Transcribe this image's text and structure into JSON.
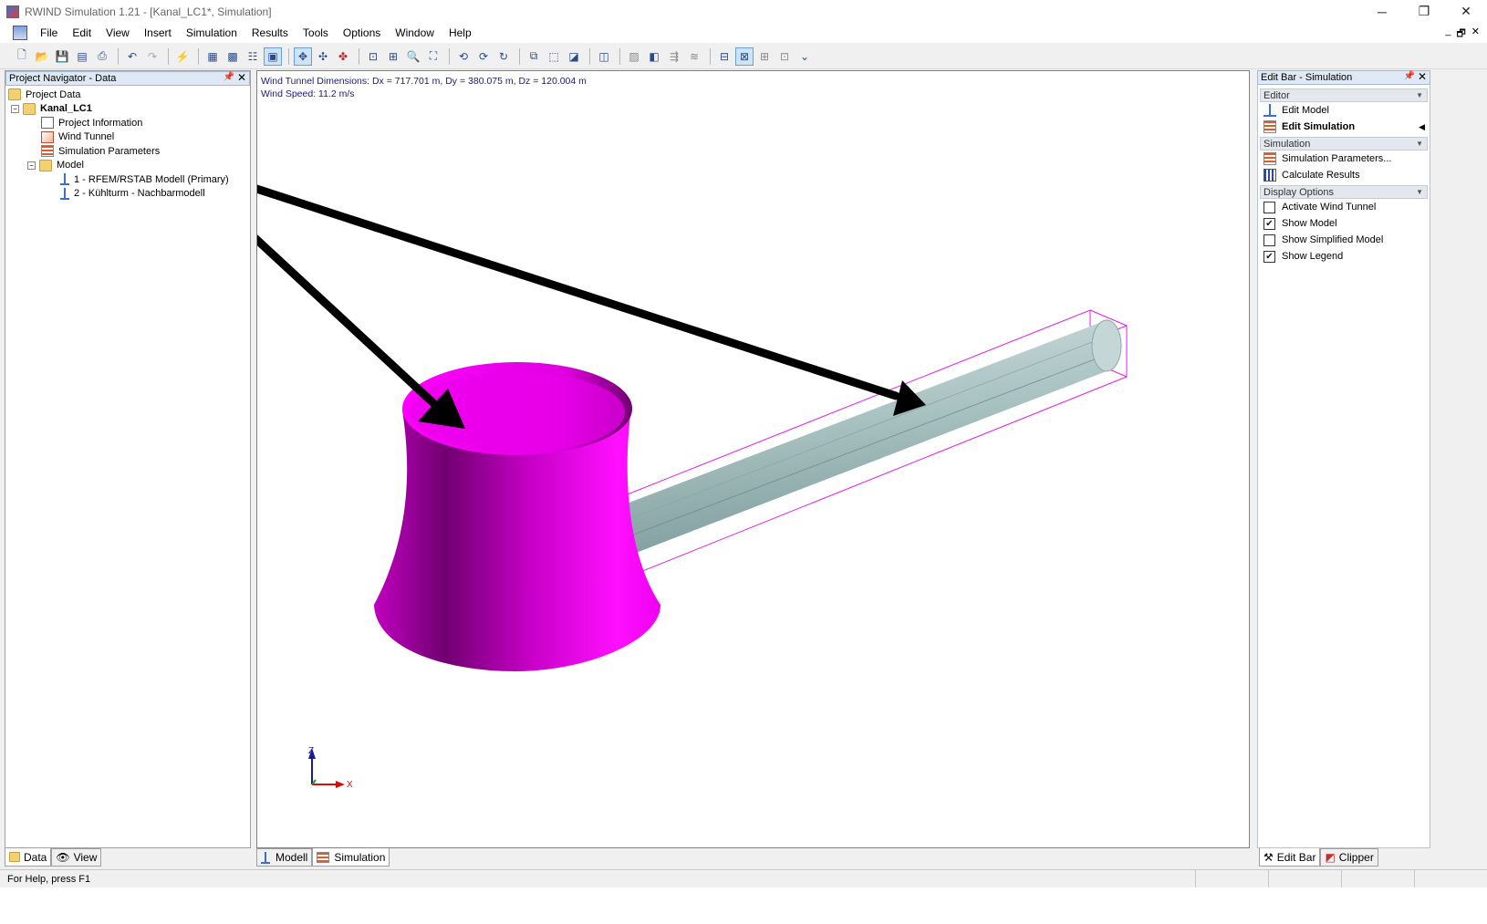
{
  "window": {
    "title": "RWIND Simulation 1.21 - [Kanal_LC1*, Simulation]",
    "controls": [
      "─",
      "❐",
      "✕"
    ]
  },
  "menu": {
    "items": [
      "File",
      "Edit",
      "View",
      "Insert",
      "Simulation",
      "Results",
      "Tools",
      "Options",
      "Window",
      "Help"
    ],
    "mdi_controls": [
      "_",
      "🗗",
      "✕"
    ]
  },
  "navigator": {
    "title": "Project Navigator - Data",
    "root": "Project Data",
    "project": "Kanal_LC1",
    "items": {
      "project_info": "Project Information",
      "wind_tunnel": "Wind Tunnel",
      "sim_params": "Simulation Parameters",
      "model": "Model",
      "model1": "1 - RFEM/RSTAB Modell (Primary)",
      "model2": "2 - Kühlturm - Nachbarmodell"
    },
    "tabs": [
      "Data",
      "View"
    ]
  },
  "viewport": {
    "dimensions": "Wind Tunnel Dimensions: Dx = 717.701 m, Dy = 380.075 m, Dz = 120.004 m",
    "wind_speed": "Wind Speed: 11.2 m/s",
    "axis_z": "Z",
    "axis_x": "X",
    "tabs": [
      "Modell",
      "Simulation"
    ],
    "colors": {
      "tower": "#e600e6",
      "pipe": "#a8c4c4",
      "tunnel_edges": "#e020e0"
    }
  },
  "editbar": {
    "title": "Edit Bar - Simulation",
    "sections": {
      "editor": "Editor",
      "simulation": "Simulation",
      "display": "Display Options"
    },
    "editor_items": {
      "edit_model": "Edit Model",
      "edit_simulation": "Edit Simulation"
    },
    "sim_items": {
      "params": "Simulation Parameters...",
      "calc": "Calculate Results"
    },
    "display_items": {
      "activate_tunnel": "Activate Wind Tunnel",
      "show_model": "Show Model",
      "show_simplified": "Show Simplified Model",
      "show_legend": "Show Legend"
    },
    "display_checked": {
      "activate_tunnel": false,
      "show_model": true,
      "show_simplified": false,
      "show_legend": true
    },
    "tabs": [
      "Edit Bar",
      "Clipper"
    ]
  },
  "status": {
    "help": "For Help, press F1"
  }
}
